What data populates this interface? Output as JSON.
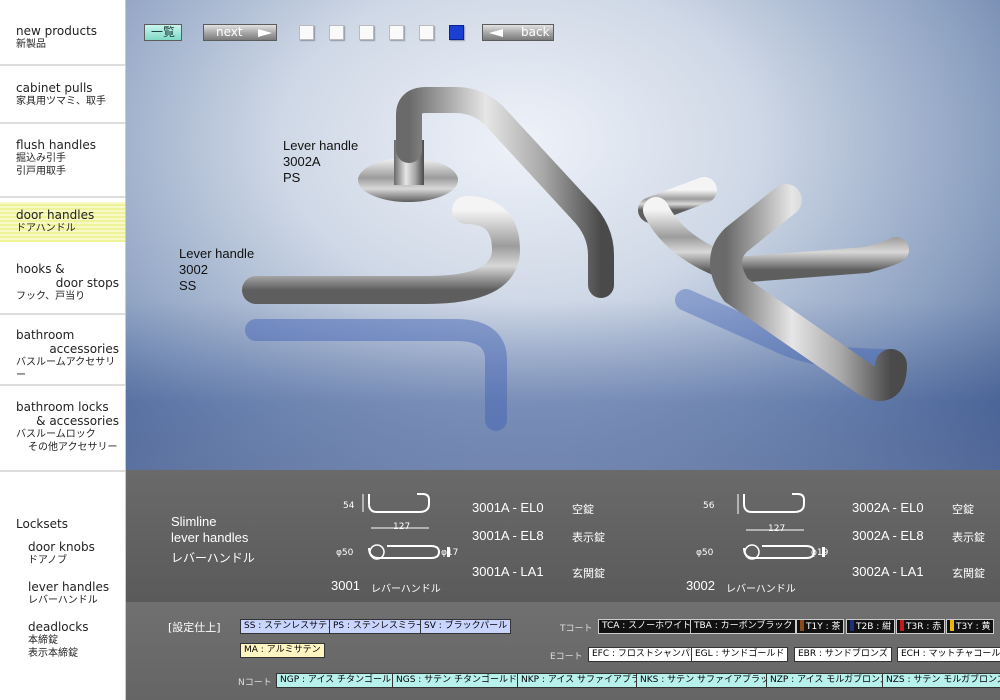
{
  "sidebar": {
    "items": [
      {
        "en": "new products",
        "ja": "新製品"
      },
      {
        "en": "cabinet pulls",
        "ja": "家具用ツマミ、取手"
      },
      {
        "en": "flush handles",
        "ja": "掘込み引手",
        "ja2": "引戸用取手"
      },
      {
        "en": "door handles",
        "ja": "ドアハンドル"
      },
      {
        "en": "hooks &",
        "en2": "door stops",
        "ja": "フック、戸当り"
      },
      {
        "en": "bathroom",
        "en2": "accessories",
        "ja": "バスルームアクセサリー"
      },
      {
        "en": "bathroom locks",
        "en2": "& accessories",
        "ja": "バスルームロック",
        "ja2": "その他アクセサリー"
      },
      {
        "en": "Locksets"
      }
    ],
    "sub_items": [
      {
        "en": "door knobs",
        "ja": "ドアノブ"
      },
      {
        "en": "lever handles",
        "ja": "レバーハンドル"
      },
      {
        "en": "deadlocks",
        "ja": "本締錠",
        "ja2": "表示本締錠"
      }
    ]
  },
  "hero": {
    "btn_list": "一覧",
    "btn_next": "next",
    "btn_back": "back",
    "label_a": [
      "Lever handle",
      "3002A",
      "PS"
    ],
    "label_b": [
      "Lever handle",
      "3002",
      "SS"
    ]
  },
  "spec": {
    "title_en_1": "Slimline",
    "title_en_2": "lever handles",
    "title_ja": "レバーハンドル",
    "left": {
      "dim_h": "54",
      "dim_w": "127",
      "dim_d1": "φ50",
      "dim_d2": "φ17",
      "model": "3001",
      "model_ja": "レバーハンドル",
      "codes": [
        {
          "code": "3001A - EL0",
          "desc": "空錠"
        },
        {
          "code": "3001A - EL8",
          "desc": "表示錠"
        },
        {
          "code": "3001A - LA1",
          "desc": "玄関錠"
        }
      ]
    },
    "right": {
      "dim_h": "56",
      "dim_w": "127",
      "dim_d1": "φ50",
      "dim_d2": "φ19",
      "model": "3002",
      "model_ja": "レバーハンドル",
      "codes": [
        {
          "code": "3002A - EL0",
          "desc": "空錠"
        },
        {
          "code": "3002A - EL8",
          "desc": "表示錠"
        },
        {
          "code": "3002A - LA1",
          "desc": "玄関錠"
        }
      ]
    }
  },
  "finish": {
    "title": "[設定仕上]",
    "standard": [
      "SS : ステンレスサテン",
      "PS : ステンレスミラー",
      "SV : ブラックパール",
      "MA : アルミサテン"
    ],
    "t_coat_label": "Tコート",
    "t_coat": [
      "TCA : スノーホワイト",
      "TBA : カーボンブラック",
      "T1Y : 茶",
      "T2B : 紺",
      "T3R : 赤",
      "T3Y : 黄"
    ],
    "e_coat_label": "Eコート",
    "e_coat": [
      "EFC : フロストシャンパン",
      "EGL : サンドゴールド",
      "EBR : サンドブロンズ",
      "ECH : マットチャコール"
    ],
    "n_coat_label": "Nコート",
    "n_coat": [
      "NGP : アイス チタンゴールド",
      "NGS : サテン チタンゴールド",
      "NKP : アイス サファイアブラック",
      "NKS : サテン サファイアブラック",
      "NZP : アイス モルガブロンズ",
      "NZS : サテン モルガブロンズ"
    ],
    "swatch_colors": {
      "T1Y": "#8a4a1a",
      "T2B": "#1b2f7a",
      "T3R": "#c51a1a",
      "T3Y": "#e8b800"
    }
  }
}
